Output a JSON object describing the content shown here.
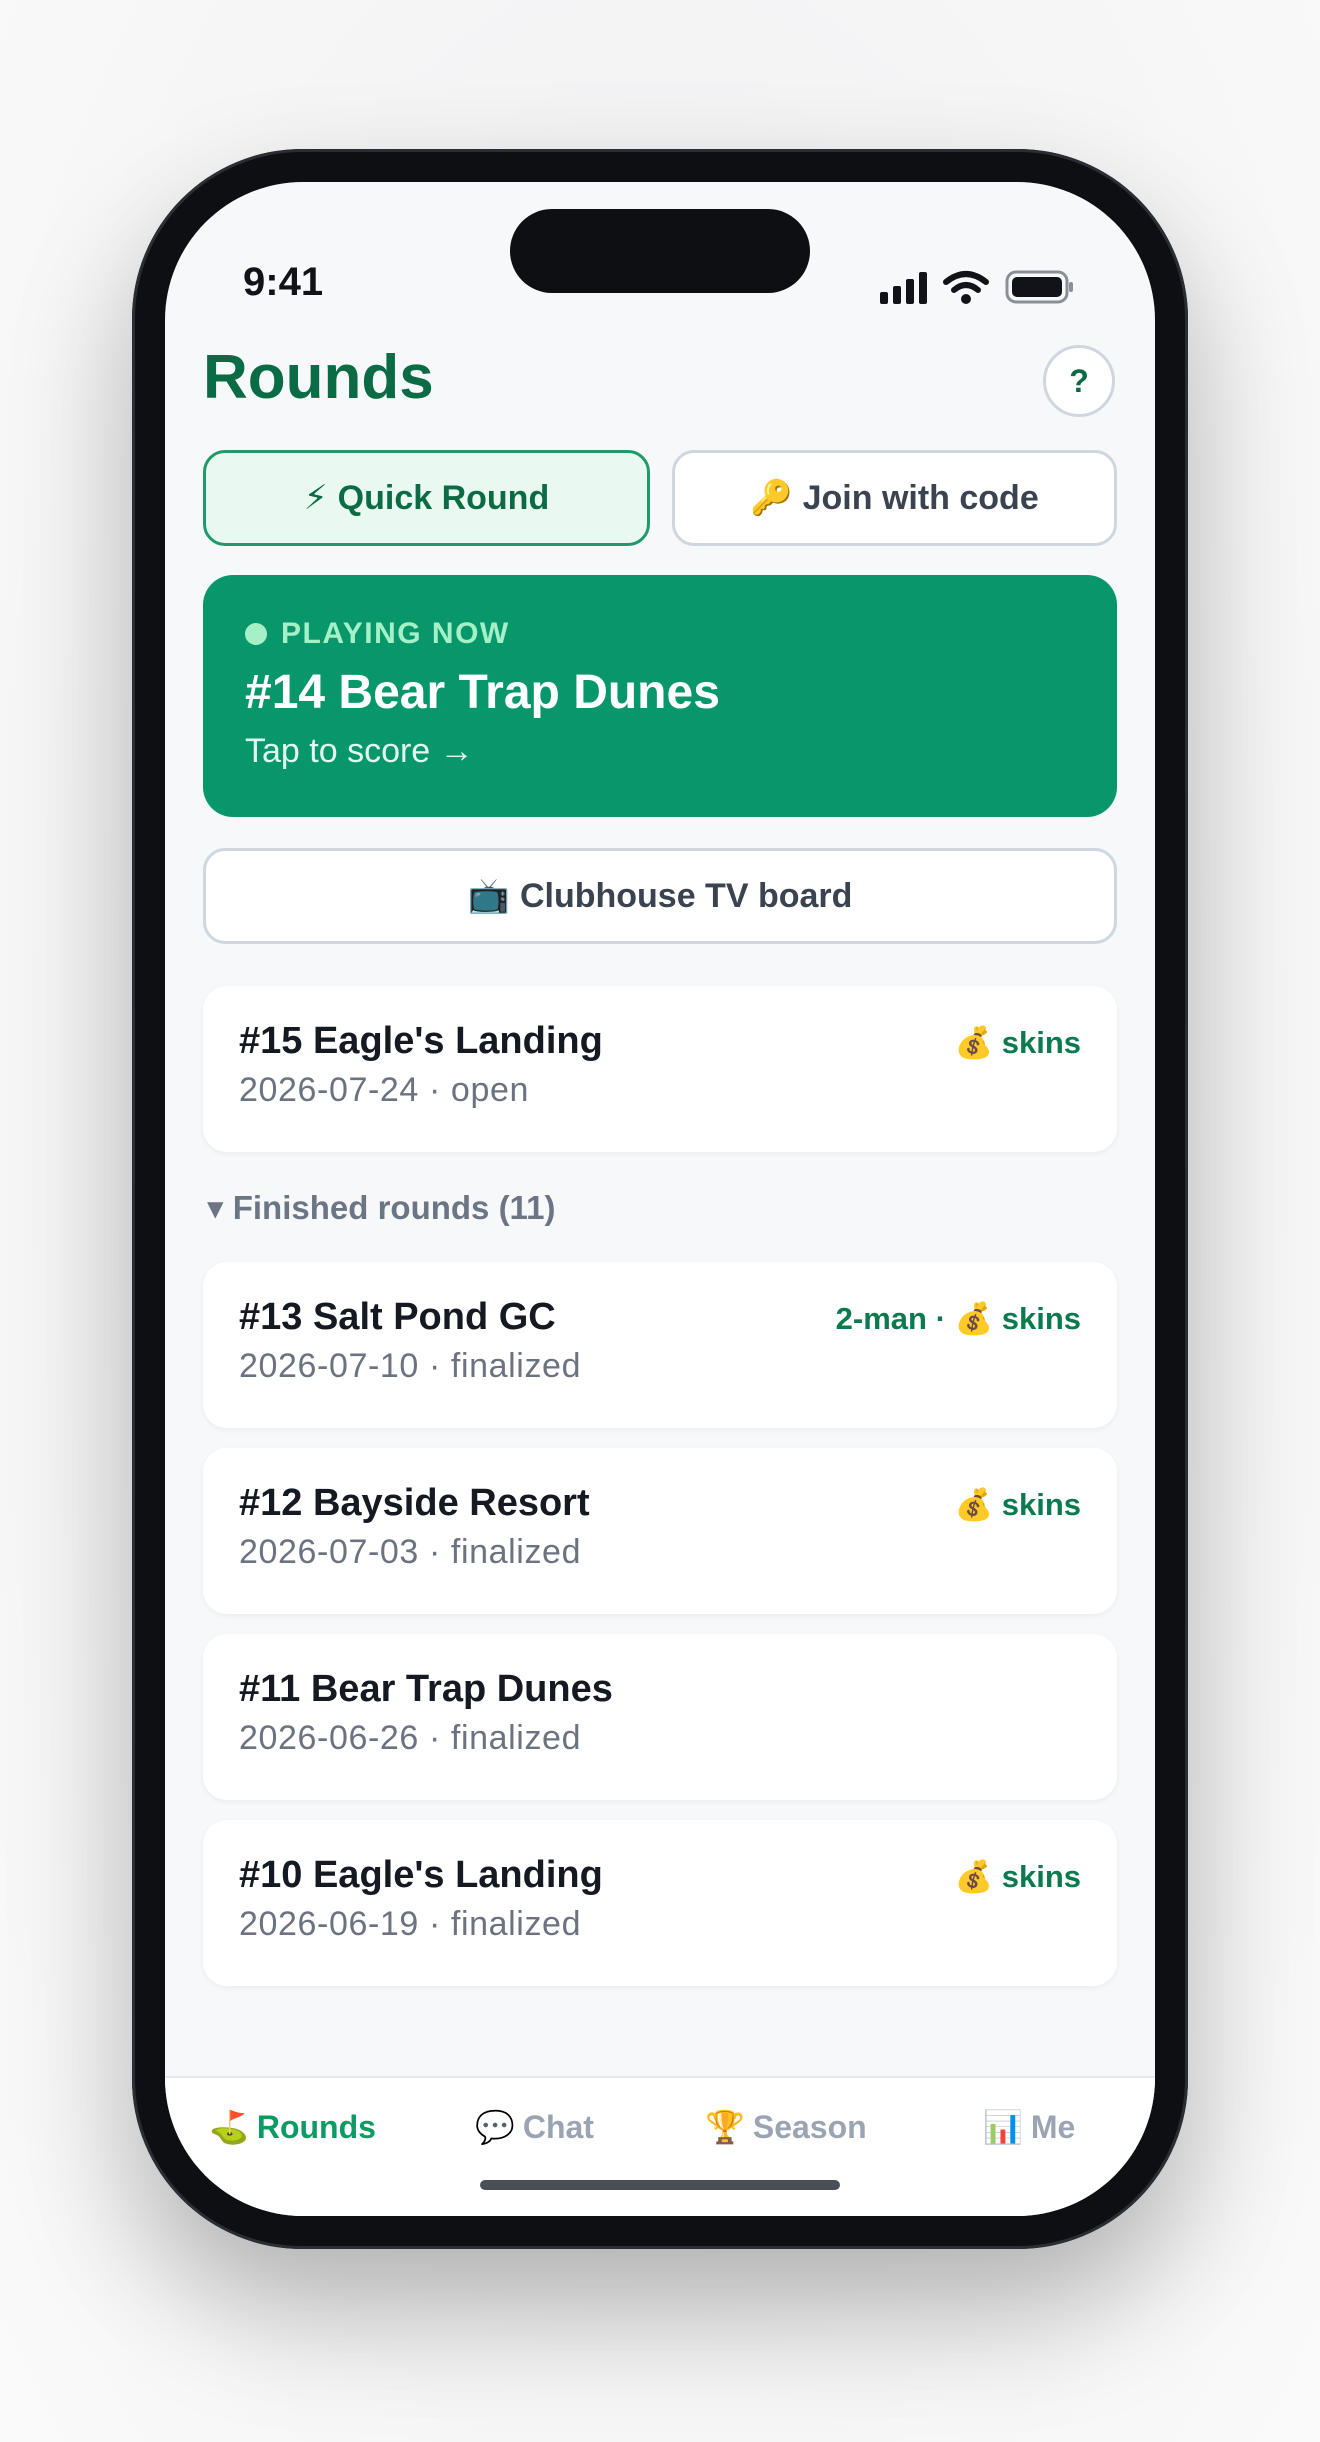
{
  "status_bar": {
    "time": "9:41"
  },
  "header": {
    "title": "Rounds",
    "help_label": "?"
  },
  "actions": {
    "quick_round_icon": "⚡",
    "quick_round": "Quick Round",
    "join_icon": "🔑",
    "join_code": "Join with code"
  },
  "playing_now": {
    "label": "PLAYING NOW",
    "title": "#14 Bear Trap Dunes",
    "subtitle": "Tap to score →"
  },
  "tv_board": {
    "icon": "📺",
    "label": "Clubhouse TV board"
  },
  "open_rounds": [
    {
      "name": "#15 Eagle's Landing",
      "meta": "2026-07-24 · open",
      "tag": "💰 skins"
    }
  ],
  "finished": {
    "header": "▾ Finished rounds (11)",
    "rounds": [
      {
        "name": "#13 Salt Pond GC",
        "meta": "2026-07-10 · finalized",
        "tag": "2-man · 💰 skins"
      },
      {
        "name": "#12 Bayside Resort",
        "meta": "2026-07-03 · finalized",
        "tag": "💰 skins"
      },
      {
        "name": "#11 Bear Trap Dunes",
        "meta": "2026-06-26 · finalized",
        "tag": ""
      },
      {
        "name": "#10 Eagle's Landing",
        "meta": "2026-06-19 · finalized",
        "tag": "💰 skins"
      }
    ]
  },
  "tabs": [
    {
      "icon": "⛳",
      "label": "Rounds",
      "active": true
    },
    {
      "icon": "💬",
      "label": "Chat",
      "active": false
    },
    {
      "icon": "🏆",
      "label": "Season",
      "active": false
    },
    {
      "icon": "📊",
      "label": "Me",
      "active": false
    }
  ],
  "colors": {
    "brand_green": "#0b6b45",
    "playing_card": "#07976a",
    "active_tab": "#0b9b63",
    "muted": "#9aa4b2"
  }
}
